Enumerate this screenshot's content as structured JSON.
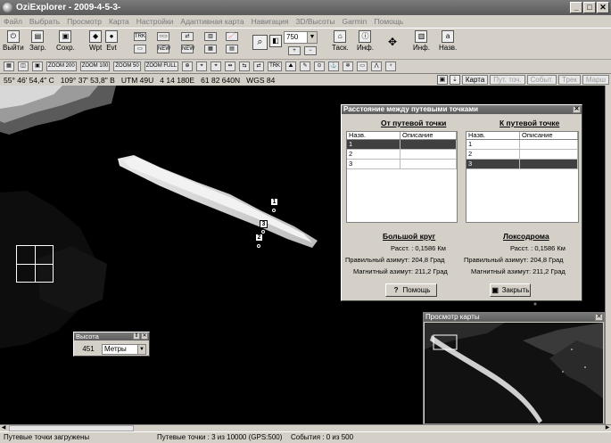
{
  "window": {
    "title": "OziExplorer - 2009-4-5-3-"
  },
  "menu": [
    "Файл",
    "Выбрать",
    "Просмотр",
    "Карта",
    "Настройки",
    "Адаптивная карта",
    "Навигация",
    "3D/Высоты",
    "Garmin",
    "Помощь"
  ],
  "toolbar": {
    "exit": "Выйти",
    "load": "Загр.",
    "save": "Сохр.",
    "wpt": "Wpt",
    "evt": "Evt",
    "zoom_value": "750",
    "task": "Таск.",
    "info": "Инф.",
    "info2": "Инф.",
    "nav": "Назв."
  },
  "toolbar2": [
    "ZOOM 200",
    "ZOOM 100",
    "ZOOM 50",
    "ZOOM FULL"
  ],
  "coordbar": {
    "coords": "55° 46' 54,4\" С   109° 37' 53,8\" В   UTM 49U   4 14 180E   61 82 640N   WGS 84",
    "modes": [
      "Карта",
      "Пут. точ.",
      "Событ.",
      "Трек",
      "Марш"
    ]
  },
  "waypoints": [
    "1",
    "3",
    "2"
  ],
  "dialog": {
    "title": "Расстояние между путевыми точками",
    "from_header": "От путевой точки",
    "to_header": "К путевой точке",
    "col_name": "Назв.",
    "col_desc": "Описание",
    "from_rows": [
      "1",
      "2",
      "3"
    ],
    "to_rows": [
      "1",
      "2",
      "3"
    ],
    "great_circle": {
      "title": "Большой круг",
      "dist_label": "Расст. :",
      "dist_value": "0,1586 Км",
      "true_label": "Правильный азимут:",
      "true_value": "204,8 Град",
      "mag_label": "Магнитный азимут:",
      "mag_value": "211,2 Град"
    },
    "rhumb": {
      "title": "Локсодрома",
      "dist_label": "Расст. :",
      "dist_value": "0,1586 Км",
      "true_label": "Правильный азимут:",
      "true_value": "204,8 Град",
      "mag_label": "Магнитный азимут:",
      "mag_value": "211,2 Град"
    },
    "help_button": "Помощь",
    "close_button": "Закрыть"
  },
  "altitude": {
    "title": "Высота",
    "value": "451",
    "unit": "Метры"
  },
  "overview": {
    "title": "Просмотр карты"
  },
  "status": {
    "left": "Путевые точки загружены",
    "mid": "Путевые точки : 3 из 10000  (GPS:500)",
    "right": "События : 0 из 500"
  }
}
